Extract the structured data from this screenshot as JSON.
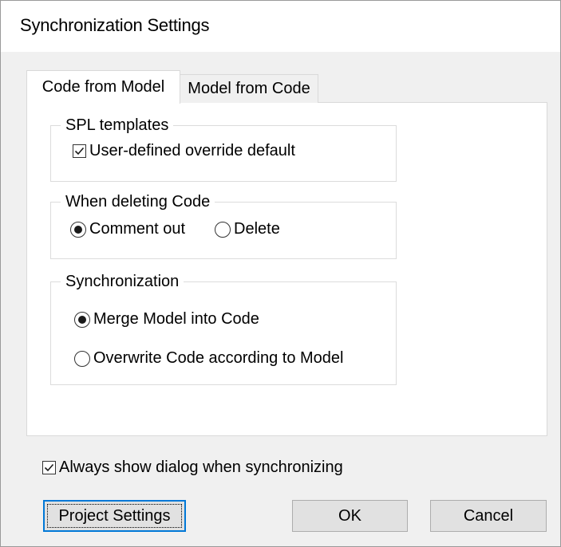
{
  "dialog": {
    "title": "Synchronization Settings"
  },
  "tabs": [
    {
      "label": "Code from Model",
      "active": true
    },
    {
      "label": "Model from Code",
      "active": false
    }
  ],
  "spl_templates": {
    "group_label": "SPL templates",
    "override_label": "User-defined override default",
    "override_checked": true
  },
  "when_deleting": {
    "group_label": "When deleting Code",
    "options": [
      {
        "label": "Comment out",
        "selected": true
      },
      {
        "label": "Delete",
        "selected": false
      }
    ]
  },
  "synchronization": {
    "group_label": "Synchronization",
    "options": [
      {
        "label": "Merge Model into Code",
        "selected": true
      },
      {
        "label": "Overwrite Code according to Model",
        "selected": false
      }
    ]
  },
  "always_show": {
    "label": "Always show dialog when synchronizing",
    "checked": true
  },
  "buttons": {
    "project_settings": "Project Settings",
    "ok": "OK",
    "cancel": "Cancel"
  },
  "colors": {
    "focus_border": "#0078d7",
    "button_face": "#e1e1e1",
    "dialog_background": "#f0f0f0"
  }
}
